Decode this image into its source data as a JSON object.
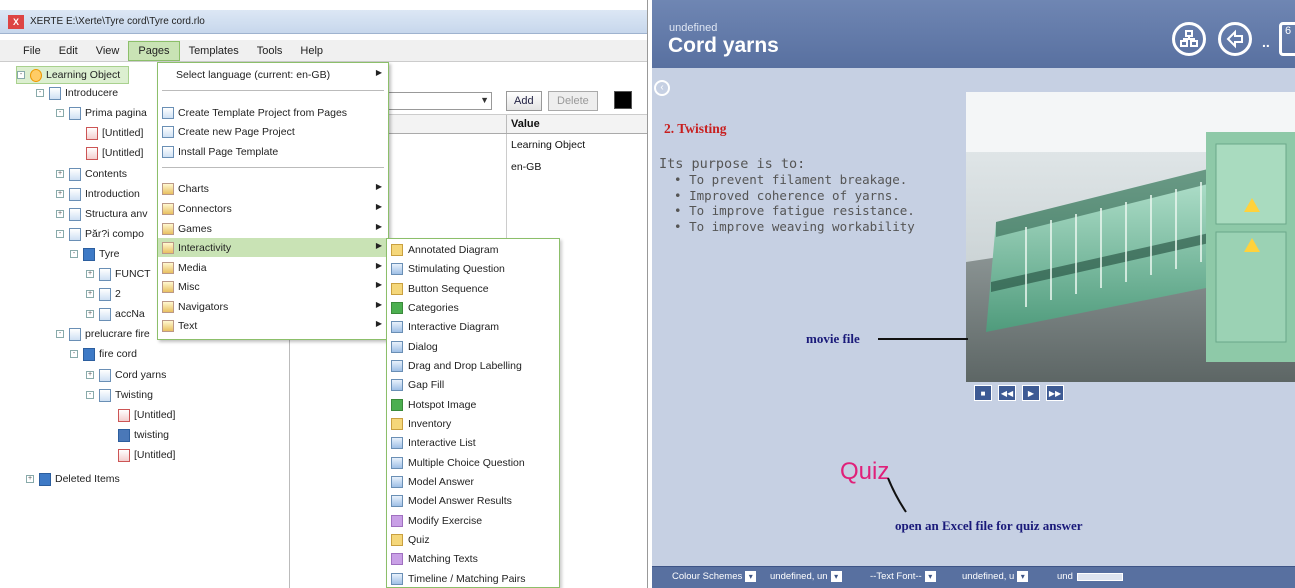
{
  "window": {
    "title": "XERTE E:\\Xerte\\Tyre cord\\Tyre cord.rlo",
    "icon_name": "xerte-app-icon"
  },
  "menubar": {
    "items": [
      "File",
      "Edit",
      "View",
      "Pages",
      "Templates",
      "Tools",
      "Help"
    ],
    "active": "Pages"
  },
  "tree": {
    "nodes": [
      {
        "label": "Learning Object",
        "icon": "learning-object-icon"
      },
      {
        "label": "Introducere",
        "icon": "page-icon"
      },
      {
        "label": "Prima pagina",
        "icon": "page-icon"
      },
      {
        "label": "[Untitled]",
        "icon": "text-item-icon"
      },
      {
        "label": "[Untitled]",
        "icon": "text-item-icon"
      },
      {
        "label": "Contents",
        "icon": "page-icon"
      },
      {
        "label": "Introduction",
        "icon": "page-icon"
      },
      {
        "label": "Structura anv",
        "icon": "page-icon"
      },
      {
        "label": "Păr?i compo",
        "icon": "page-icon"
      },
      {
        "label": "Tyre",
        "icon": "folder-icon"
      },
      {
        "label": "FUNCT",
        "icon": "page-icon"
      },
      {
        "label": "2",
        "icon": "page-icon"
      },
      {
        "label": "accNa",
        "icon": "navigator-icon"
      },
      {
        "label": "prelucrare fire",
        "icon": "page-icon"
      },
      {
        "label": "fire cord",
        "icon": "folder-icon"
      },
      {
        "label": "Cord yarns",
        "icon": "navigator-icon"
      },
      {
        "label": "Twisting",
        "icon": "page-icon"
      },
      {
        "label": "[Untitled]",
        "icon": "text-item-icon"
      },
      {
        "label": "twisting",
        "icon": "movie-icon"
      },
      {
        "label": "[Untitled]",
        "icon": "text-item-icon"
      },
      {
        "label": "Deleted Items",
        "icon": "trash-icon"
      }
    ]
  },
  "properties": {
    "add_label": "Add",
    "delete_label": "Delete",
    "value_header": "Value",
    "rows": [
      "Learning Object",
      "en-GB"
    ]
  },
  "pages_menu": {
    "select_language": "Select language (current: en-GB)",
    "items_a": [
      "Create Template Project from Pages",
      "Create new Page Project",
      "Install Page Template"
    ],
    "items_b": [
      "Charts",
      "Connectors",
      "Games",
      "Interactivity",
      "Media",
      "Misc",
      "Navigators",
      "Text"
    ],
    "highlighted": "Interactivity"
  },
  "interactivity_menu": {
    "items": [
      "Annotated Diagram",
      "Stimulating Question",
      "Button Sequence",
      "Categories",
      "Interactive Diagram",
      "Dialog",
      "Drag and Drop Labelling",
      "Gap Fill",
      "Hotspot Image",
      "Inventory",
      "Interactive List",
      "Multiple Choice Question",
      "Model Answer",
      "Model Answer Results",
      "Modify Exercise",
      "Quiz",
      "Matching Texts",
      "Timeline / Matching Pairs"
    ]
  },
  "preview": {
    "subtitle": "undefined",
    "title": "Cord yarns",
    "section_heading": "2. Twisting",
    "purpose_intro": "Its purpose is to:",
    "bullets": [
      "To prevent filament breakage.",
      "Improved coherence of yarns.",
      "To improve fatigue resistance.",
      "To improve weaving workability"
    ],
    "corner_text": "6",
    "dots": "..",
    "movie_label": "movie file",
    "quiz_label": "Quiz",
    "quiz_note": "open an Excel file for quiz answer",
    "colors": {
      "header": "#5870a0",
      "heading": "#c81e1e",
      "quiz": "#e0207a",
      "annotation": "#1a1a7a",
      "background": "#c6d0e3"
    },
    "footer": {
      "colour_schemes": "Colour Schemes",
      "undefined_1": "undefined, un",
      "text_font": "--Text Font--",
      "undefined_2": "undefined, u",
      "undefined_3": "und"
    }
  }
}
